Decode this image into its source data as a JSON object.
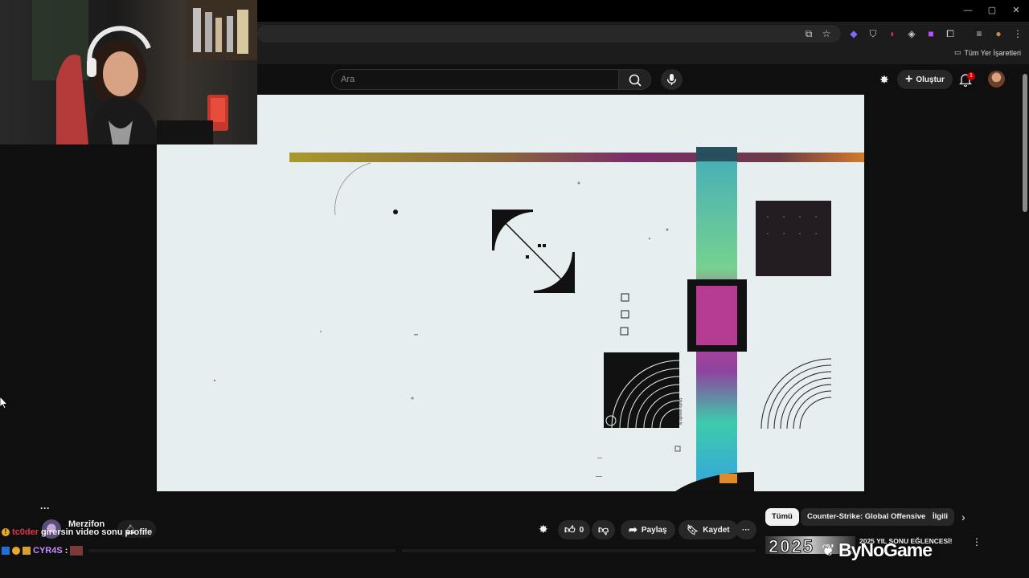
{
  "browser": {
    "bookmarks_all": "Tüm Yer İşaretleri",
    "icons": [
      "minimize-icon",
      "maximize-icon",
      "close-icon"
    ]
  },
  "youtube": {
    "search_placeholder": "Ara",
    "create_label": "Oluştur",
    "notification_count": "1"
  },
  "video": {
    "caption_vertical": "blurly pesolb tv"
  },
  "channel": {
    "name": "Merzifon"
  },
  "actions": {
    "like_count": "0",
    "share_label": "Paylaş",
    "save_label": "Kaydet"
  },
  "chips": [
    "Tümü",
    "Counter-Strike: Global Offensive",
    "İlgili"
  ],
  "recommendation": {
    "title": "2025 YIL SONU EĞLENCESİ!",
    "thumb_text": "2025"
  },
  "chat": [
    {
      "user": "tc0der",
      "message": "girersin video sonu profile",
      "user_color": "#e0344e"
    },
    {
      "user": "CYR4S",
      "message": ":",
      "user_color": "#c38cff"
    }
  ],
  "watermark": "ByNoGame",
  "colors": {
    "bg": "#0f0f0f",
    "video_bg": "#e7eef0",
    "accent_red": "#cc0000"
  }
}
